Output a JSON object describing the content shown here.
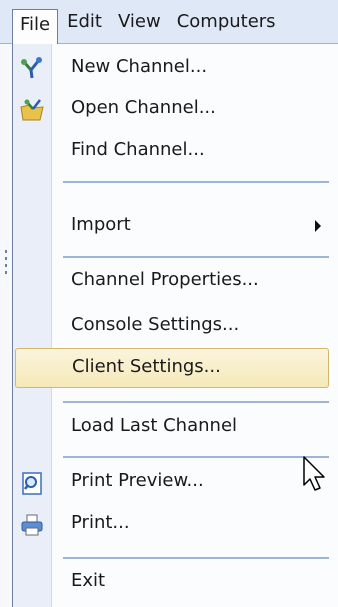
{
  "menubar": {
    "items": [
      {
        "label": "File",
        "active": true
      },
      {
        "label": "Edit",
        "active": false
      },
      {
        "label": "View",
        "active": false
      },
      {
        "label": "Computers",
        "active": false
      }
    ]
  },
  "file_menu": {
    "items": [
      {
        "label": "New Channel...",
        "icon": "new-channel-icon"
      },
      {
        "label": "Open Channel...",
        "icon": "open-channel-icon"
      },
      {
        "label": "Find Channel...",
        "icon": null
      },
      {
        "label": "Import",
        "icon": null,
        "submenu": true
      },
      {
        "label": "Channel Properties...",
        "icon": null
      },
      {
        "label": "Console Settings...",
        "icon": null
      },
      {
        "label": "Client Settings...",
        "icon": null,
        "highlighted": true
      },
      {
        "label": "Load Last Channel",
        "icon": null
      },
      {
        "label": "Print Preview...",
        "icon": "print-preview-icon"
      },
      {
        "label": "Print...",
        "icon": "print-icon"
      },
      {
        "label": "Exit",
        "icon": null
      }
    ]
  },
  "colors": {
    "menubar_bg": "#dfe8f6",
    "menu_bg": "#fbfcfe",
    "icon_column_bg": "#e9eef8",
    "highlight_bg": "#f5e9b9",
    "highlight_border": "#d2b86c",
    "separator": "#9fb5d8"
  }
}
